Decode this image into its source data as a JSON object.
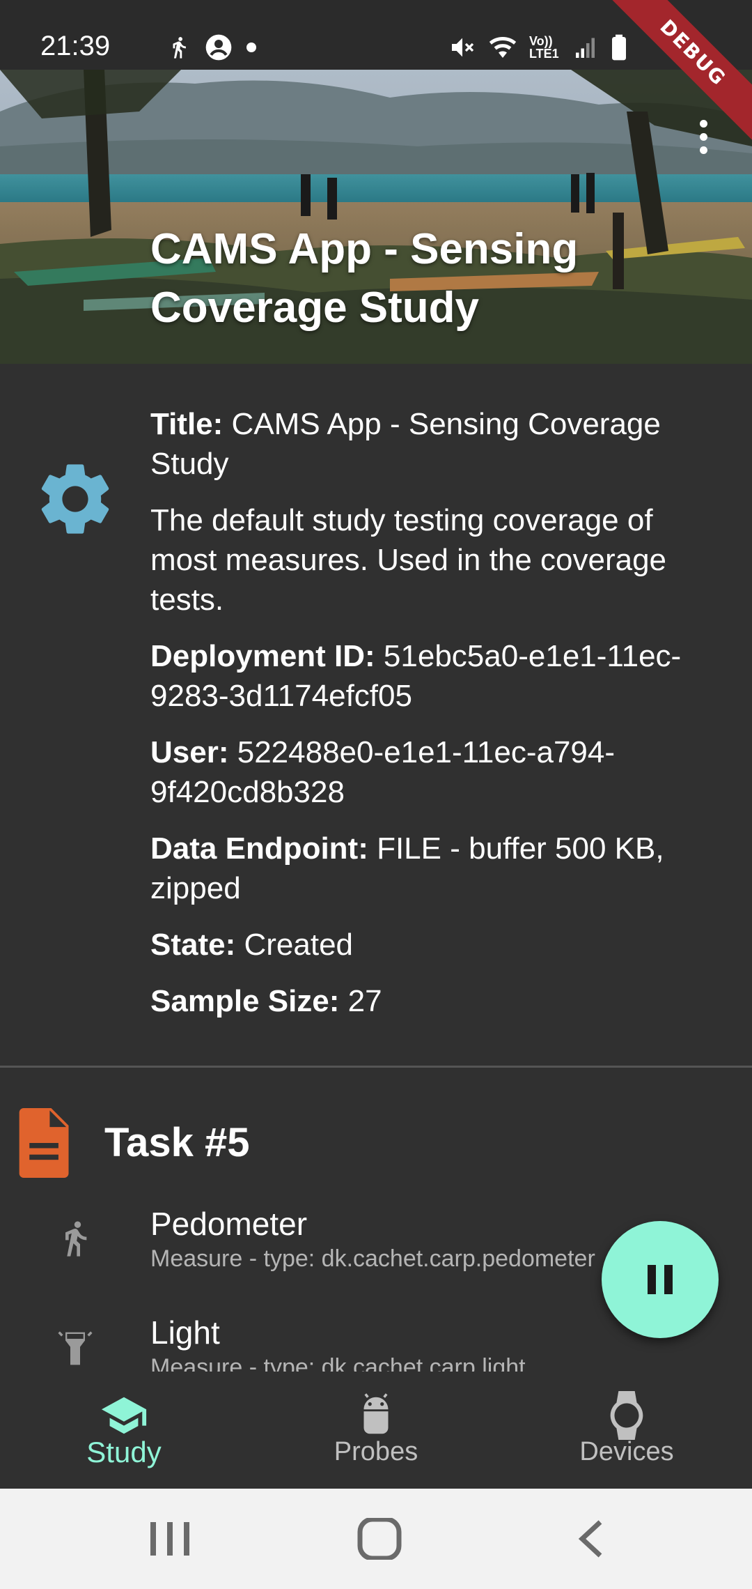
{
  "status_bar": {
    "time": "21:39",
    "left_icons": [
      "walk-icon",
      "account-circle-icon",
      "dot-icon"
    ],
    "right_icons": [
      "mute-icon",
      "wifi-icon",
      "volte-icon",
      "signal-icon",
      "battery-icon"
    ],
    "volte_text": "Vo)) LTE1"
  },
  "debug_banner": "DEBUG",
  "header": {
    "title": "CAMS App - Sensing Coverage Study"
  },
  "study": {
    "title_label": "Title:",
    "title_value": " CAMS App - Sensing Coverage Study",
    "description": "The default study testing coverage of most measures. Used in the coverage tests.",
    "deployment_label": "Deployment ID:",
    "deployment_value": " 51ebc5a0-e1e1-11ec-9283-3d1174efcf05",
    "user_label": "User:",
    "user_value": " 522488e0-e1e1-11ec-a794-9f420cd8b328",
    "endpoint_label": "Data Endpoint:",
    "endpoint_value": " FILE - buffer 500 KB, zipped",
    "state_label": "State:",
    "state_value": " Created",
    "sample_label": "Sample Size:",
    "sample_value": " 27"
  },
  "task": {
    "title": "Task #5",
    "measures": [
      {
        "name": "Pedometer",
        "type": "Measure - type: dk.cachet.carp.pedometer",
        "icon": "walk-icon"
      },
      {
        "name": "Light",
        "type": "Measure - type: dk.cachet.carp.light",
        "icon": "flashlight-icon"
      }
    ]
  },
  "fab": {
    "icon": "pause-icon"
  },
  "bottom_nav": {
    "items": [
      {
        "label": "Study",
        "icon": "school-icon",
        "active": true
      },
      {
        "label": "Probes",
        "icon": "android-icon",
        "active": false
      },
      {
        "label": "Devices",
        "icon": "watch-icon",
        "active": false
      }
    ]
  },
  "colors": {
    "background": "#303030",
    "accent": "#8ff4d7",
    "gear": "#6ab4d1",
    "task_icon": "#e0632d",
    "debug": "#a3262c"
  }
}
